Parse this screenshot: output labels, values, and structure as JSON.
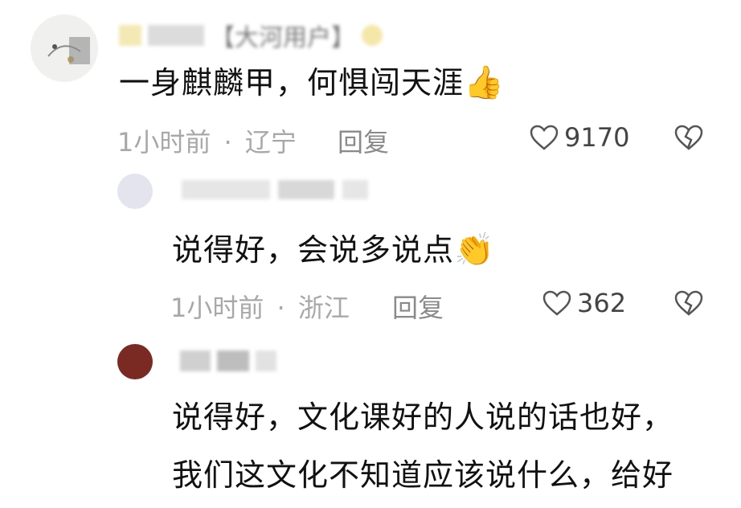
{
  "comments": [
    {
      "username": "【大河用户】",
      "text": "一身麒麟甲，何惧闯天涯",
      "emoji": "👍",
      "time": "1小时前",
      "location": "辽宁",
      "reply_label": "回复",
      "likes": "9170"
    },
    {
      "username": "",
      "text": "说得好，会说多说点",
      "emoji": "👏",
      "time": "1小时前",
      "location": "浙江",
      "reply_label": "回复",
      "likes": "362"
    },
    {
      "username": "",
      "text_line1": "说得好，文化课好的人说的话也好，",
      "text_line2": "我们这文化不知道应该说什么，给好"
    }
  ],
  "separator": "·",
  "colors": {
    "meta_gray": "#a8a8a8",
    "reply_gray": "#8a8a8a",
    "icon_gray": "#555555",
    "avatar3": "#7a2a22"
  }
}
